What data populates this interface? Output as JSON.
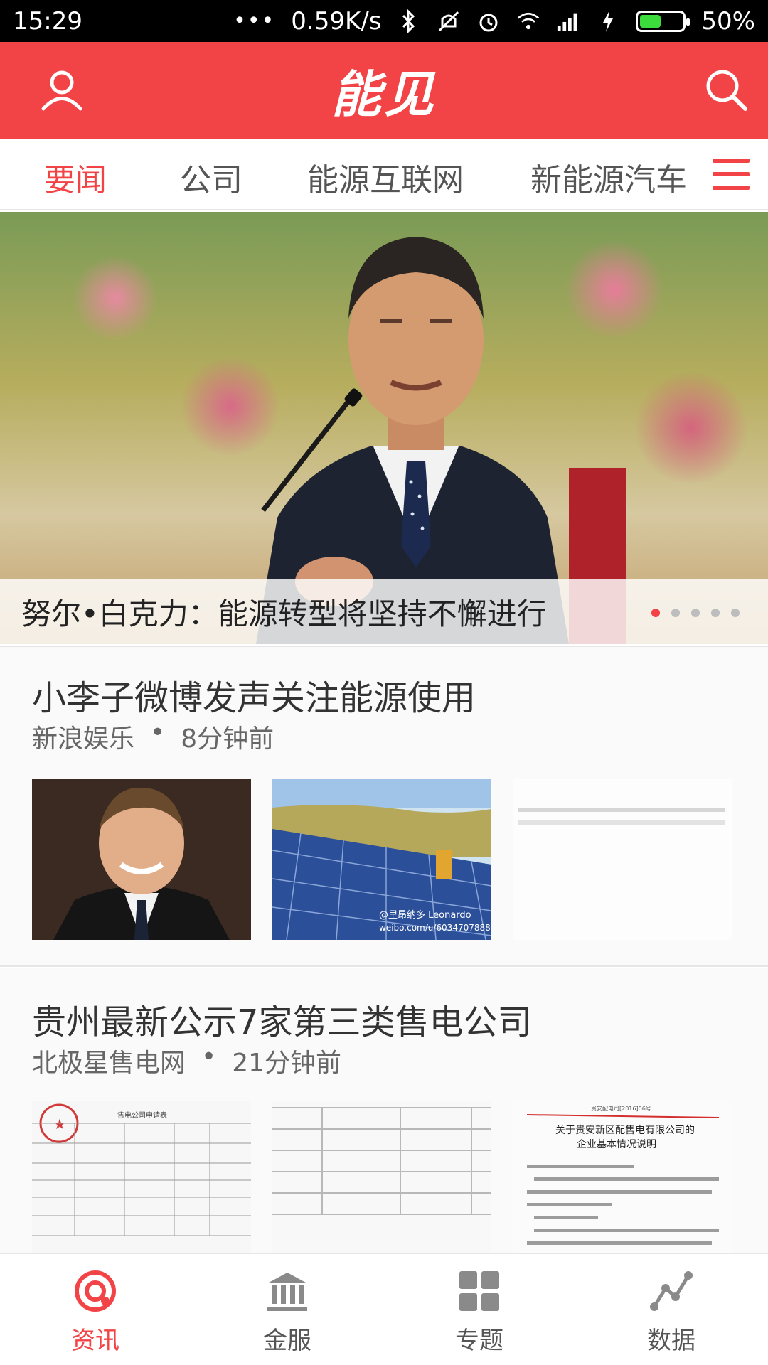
{
  "status_bar": {
    "time": "15:29",
    "dots": "•••",
    "net_speed": "0.59K/s",
    "battery_percent": "50%",
    "battery_level": 0.5,
    "icons": [
      "bluetooth-icon",
      "mute-icon",
      "alarm-icon",
      "wifi-icon",
      "signal-icon",
      "charging-icon",
      "battery-icon"
    ]
  },
  "header": {
    "logo": "能见",
    "left_icon": "user-icon",
    "right_icon": "search-icon",
    "accent_color": "#f24446"
  },
  "tabs": {
    "items": [
      {
        "label": "要闻",
        "active": true
      },
      {
        "label": "公司",
        "active": false
      },
      {
        "label": "能源互联网",
        "active": false
      },
      {
        "label": "新能源汽车",
        "active": false
      }
    ],
    "menu_icon": "hamburger-menu-icon"
  },
  "hero": {
    "caption": "努尔•白克力：能源转型将坚持不懈进行",
    "slide_count": 5,
    "active_slide": 1
  },
  "news": [
    {
      "title": "小李子微博发声关注能源使用",
      "source": "新浪娱乐",
      "separator": "•",
      "time": "8分钟前",
      "thumbnails": [
        "portrait-photo",
        "solar-panel-photo",
        "text-document-photo"
      ],
      "thumb_watermark": "@里昂纳多 Leonardo weibo.com/u/6034707888"
    },
    {
      "title": "贵州最新公示7家第三类售电公司",
      "source": "北极星售电网",
      "separator": "•",
      "time": "21分钟前",
      "thumbnails": [
        "application-form-photo",
        "table-document-photo",
        "official-letter-photo"
      ],
      "doc1_heading": "售电公司申请表",
      "doc3_number": "贵安配电司[2016]06号",
      "doc3_title_line1": "关于贵安新区配售电有限公司的",
      "doc3_title_line2": "企业基本情况说明"
    }
  ],
  "bottom_nav": {
    "items": [
      {
        "label": "资讯",
        "icon": "news-feed-icon",
        "active": true
      },
      {
        "label": "金服",
        "icon": "bank-icon",
        "active": false
      },
      {
        "label": "专题",
        "icon": "grid-icon",
        "active": false
      },
      {
        "label": "数据",
        "icon": "data-chart-icon",
        "active": false
      }
    ]
  }
}
